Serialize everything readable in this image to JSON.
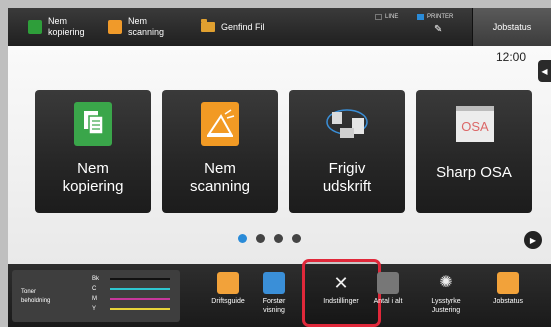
{
  "topbar": {
    "nem_kopiering": "Nem\nkopiering",
    "nem_scanning": "Nem\nscanning",
    "genfind_fil": "Genfind Fil",
    "line": "LINE",
    "printer": "PRINTER",
    "jobstatus": "Jobstatus"
  },
  "main": {
    "clock": "12:00",
    "tiles": [
      {
        "label": "Nem\nkopiering",
        "icon": "copy-icon"
      },
      {
        "label": "Nem\nscanning",
        "icon": "scan-icon"
      },
      {
        "label": "Frigiv\nudskrift",
        "icon": "print-release-icon"
      },
      {
        "label": "Sharp OSA",
        "icon": "sharp-osa-icon"
      }
    ]
  },
  "bottombar": {
    "toner_title": "Toner\nbeholdning",
    "toner": [
      {
        "code": "Bk",
        "color": "#111111"
      },
      {
        "code": "C",
        "color": "#2fc6cf"
      },
      {
        "code": "M",
        "color": "#c6389c"
      },
      {
        "code": "Y",
        "color": "#e6d33a"
      }
    ],
    "items": [
      {
        "label": "Driftsguide",
        "icon": "guide-icon"
      },
      {
        "label": "Forstør\nvisning",
        "icon": "enlarge-icon"
      },
      {
        "label": "Indstillinger",
        "icon": "settings-icon"
      },
      {
        "label": "Antal i alt",
        "icon": "counter-icon"
      },
      {
        "label": "Lysstyrke\nJustering",
        "icon": "brightness-icon"
      },
      {
        "label": "Jobstatus",
        "icon": "jobstatus-icon"
      }
    ]
  },
  "colors": {
    "accent": "#2a8bd8",
    "highlight": "#e0283a"
  }
}
